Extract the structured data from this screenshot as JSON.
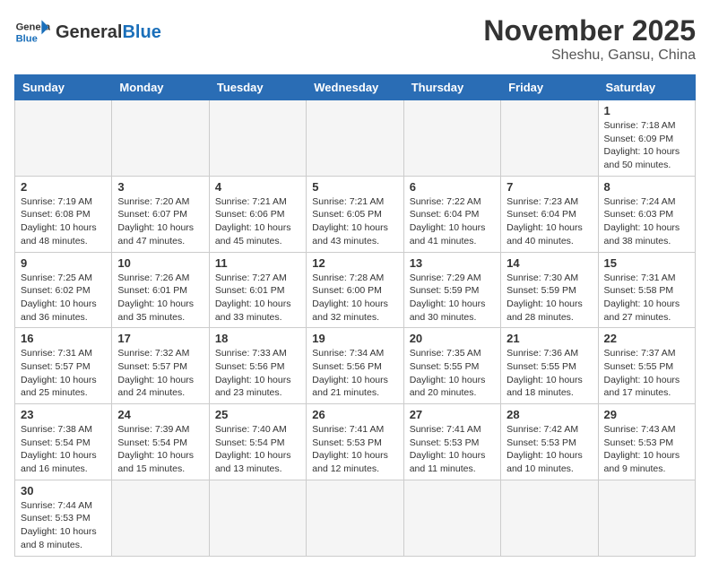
{
  "header": {
    "logo_general": "General",
    "logo_blue": "Blue",
    "month": "November 2025",
    "location": "Sheshu, Gansu, China"
  },
  "weekdays": [
    "Sunday",
    "Monday",
    "Tuesday",
    "Wednesday",
    "Thursday",
    "Friday",
    "Saturday"
  ],
  "weeks": [
    [
      {
        "day": "",
        "info": ""
      },
      {
        "day": "",
        "info": ""
      },
      {
        "day": "",
        "info": ""
      },
      {
        "day": "",
        "info": ""
      },
      {
        "day": "",
        "info": ""
      },
      {
        "day": "",
        "info": ""
      },
      {
        "day": "1",
        "info": "Sunrise: 7:18 AM\nSunset: 6:09 PM\nDaylight: 10 hours and 50 minutes."
      }
    ],
    [
      {
        "day": "2",
        "info": "Sunrise: 7:19 AM\nSunset: 6:08 PM\nDaylight: 10 hours and 48 minutes."
      },
      {
        "day": "3",
        "info": "Sunrise: 7:20 AM\nSunset: 6:07 PM\nDaylight: 10 hours and 47 minutes."
      },
      {
        "day": "4",
        "info": "Sunrise: 7:21 AM\nSunset: 6:06 PM\nDaylight: 10 hours and 45 minutes."
      },
      {
        "day": "5",
        "info": "Sunrise: 7:21 AM\nSunset: 6:05 PM\nDaylight: 10 hours and 43 minutes."
      },
      {
        "day": "6",
        "info": "Sunrise: 7:22 AM\nSunset: 6:04 PM\nDaylight: 10 hours and 41 minutes."
      },
      {
        "day": "7",
        "info": "Sunrise: 7:23 AM\nSunset: 6:04 PM\nDaylight: 10 hours and 40 minutes."
      },
      {
        "day": "8",
        "info": "Sunrise: 7:24 AM\nSunset: 6:03 PM\nDaylight: 10 hours and 38 minutes."
      }
    ],
    [
      {
        "day": "9",
        "info": "Sunrise: 7:25 AM\nSunset: 6:02 PM\nDaylight: 10 hours and 36 minutes."
      },
      {
        "day": "10",
        "info": "Sunrise: 7:26 AM\nSunset: 6:01 PM\nDaylight: 10 hours and 35 minutes."
      },
      {
        "day": "11",
        "info": "Sunrise: 7:27 AM\nSunset: 6:01 PM\nDaylight: 10 hours and 33 minutes."
      },
      {
        "day": "12",
        "info": "Sunrise: 7:28 AM\nSunset: 6:00 PM\nDaylight: 10 hours and 32 minutes."
      },
      {
        "day": "13",
        "info": "Sunrise: 7:29 AM\nSunset: 5:59 PM\nDaylight: 10 hours and 30 minutes."
      },
      {
        "day": "14",
        "info": "Sunrise: 7:30 AM\nSunset: 5:59 PM\nDaylight: 10 hours and 28 minutes."
      },
      {
        "day": "15",
        "info": "Sunrise: 7:31 AM\nSunset: 5:58 PM\nDaylight: 10 hours and 27 minutes."
      }
    ],
    [
      {
        "day": "16",
        "info": "Sunrise: 7:31 AM\nSunset: 5:57 PM\nDaylight: 10 hours and 25 minutes."
      },
      {
        "day": "17",
        "info": "Sunrise: 7:32 AM\nSunset: 5:57 PM\nDaylight: 10 hours and 24 minutes."
      },
      {
        "day": "18",
        "info": "Sunrise: 7:33 AM\nSunset: 5:56 PM\nDaylight: 10 hours and 23 minutes."
      },
      {
        "day": "19",
        "info": "Sunrise: 7:34 AM\nSunset: 5:56 PM\nDaylight: 10 hours and 21 minutes."
      },
      {
        "day": "20",
        "info": "Sunrise: 7:35 AM\nSunset: 5:55 PM\nDaylight: 10 hours and 20 minutes."
      },
      {
        "day": "21",
        "info": "Sunrise: 7:36 AM\nSunset: 5:55 PM\nDaylight: 10 hours and 18 minutes."
      },
      {
        "day": "22",
        "info": "Sunrise: 7:37 AM\nSunset: 5:55 PM\nDaylight: 10 hours and 17 minutes."
      }
    ],
    [
      {
        "day": "23",
        "info": "Sunrise: 7:38 AM\nSunset: 5:54 PM\nDaylight: 10 hours and 16 minutes."
      },
      {
        "day": "24",
        "info": "Sunrise: 7:39 AM\nSunset: 5:54 PM\nDaylight: 10 hours and 15 minutes."
      },
      {
        "day": "25",
        "info": "Sunrise: 7:40 AM\nSunset: 5:54 PM\nDaylight: 10 hours and 13 minutes."
      },
      {
        "day": "26",
        "info": "Sunrise: 7:41 AM\nSunset: 5:53 PM\nDaylight: 10 hours and 12 minutes."
      },
      {
        "day": "27",
        "info": "Sunrise: 7:41 AM\nSunset: 5:53 PM\nDaylight: 10 hours and 11 minutes."
      },
      {
        "day": "28",
        "info": "Sunrise: 7:42 AM\nSunset: 5:53 PM\nDaylight: 10 hours and 10 minutes."
      },
      {
        "day": "29",
        "info": "Sunrise: 7:43 AM\nSunset: 5:53 PM\nDaylight: 10 hours and 9 minutes."
      }
    ],
    [
      {
        "day": "30",
        "info": "Sunrise: 7:44 AM\nSunset: 5:53 PM\nDaylight: 10 hours and 8 minutes."
      },
      {
        "day": "",
        "info": ""
      },
      {
        "day": "",
        "info": ""
      },
      {
        "day": "",
        "info": ""
      },
      {
        "day": "",
        "info": ""
      },
      {
        "day": "",
        "info": ""
      },
      {
        "day": "",
        "info": ""
      }
    ]
  ]
}
